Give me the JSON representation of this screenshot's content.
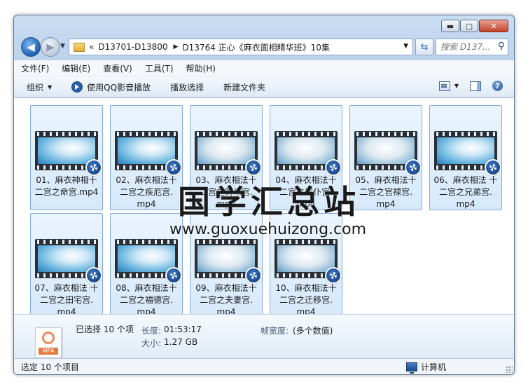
{
  "window": {
    "controls": {
      "minimize": "▬",
      "maximize": "▢",
      "close": "✕"
    }
  },
  "nav": {
    "back_glyph": "◀",
    "forward_glyph": "▶",
    "breadcrumb_prefix": "«",
    "breadcrumbs": [
      "D13701-D13800",
      "D13764 正心《麻衣面相精华班》10集"
    ],
    "search_placeholder": "搜索 D137..."
  },
  "menu": [
    "文件(F)",
    "编辑(E)",
    "查看(V)",
    "工具(T)",
    "帮助(H)"
  ],
  "toolbar": {
    "organize": "组织",
    "play_qq": "使用QQ影音播放",
    "play_select": "播放选择",
    "new_folder": "新建文件夹"
  },
  "files": [
    {
      "name": "01、麻衣神相十二宫之命宫.mp4",
      "lines": [
        "01、麻衣神相十",
        "二宫之命宫.mp4"
      ]
    },
    {
      "name": "02、麻衣相法十二宫之疾厄宫.mp4",
      "lines": [
        "02、麻衣相法十",
        "二宫之疾厄宫.",
        "mp4"
      ]
    },
    {
      "name": "03、麻衣相法十二宫之财帛宫.mp4",
      "lines": [
        "03、麻衣相法十",
        "二宫之财帛宫.",
        "mp4"
      ]
    },
    {
      "name": "04、麻衣相法十二宫之奴仆宫.mp4",
      "lines": [
        "04、麻衣相法十",
        "二宫之奴仆宫.",
        "mp4"
      ]
    },
    {
      "name": "05、麻衣相法十二宫之官禄宫.mp4",
      "lines": [
        "05、麻衣相法十",
        "二宫之官禄宫.",
        "mp4"
      ]
    },
    {
      "name": "06、麻衣相法 十二宫之兄弟宫.mp4",
      "lines": [
        "06、麻衣相法 十",
        "二宫之兄弟宫.",
        "mp4"
      ]
    },
    {
      "name": "07、麻衣相法 十二宫之田宅宫.mp4",
      "lines": [
        "07、麻衣相法 十",
        "二宫之田宅宫.",
        "mp4"
      ]
    },
    {
      "name": "08、麻衣相法十二宫之福德宫.mp4",
      "lines": [
        "08、麻衣相法十",
        "二宫之福德宫.",
        "mp4"
      ]
    },
    {
      "name": "09、麻衣相法十二宫之夫妻宫.mp4",
      "lines": [
        "09、麻衣相法十",
        "二宫之夫妻宫.",
        "mp4"
      ]
    },
    {
      "name": "10、麻衣相法十二宫之迁移宫.mp4",
      "lines": [
        "10、麻衣相法十",
        "二宫之迁移宫.",
        "mp4"
      ]
    }
  ],
  "watermark": {
    "cn": "国学汇总站",
    "en": "www.guoxuehuizong.com"
  },
  "details": {
    "selected": "已选择 10 个项",
    "length_label": "长度:",
    "length_value": "01:53:17",
    "size_label": "大小:",
    "size_value": "1.27 GB",
    "frame_width_label": "帧宽度:",
    "frame_width_value": "(多个数值)",
    "file_icon_tag": "MP4"
  },
  "status": {
    "left": "选定 10 个项目",
    "right": "计算机"
  }
}
